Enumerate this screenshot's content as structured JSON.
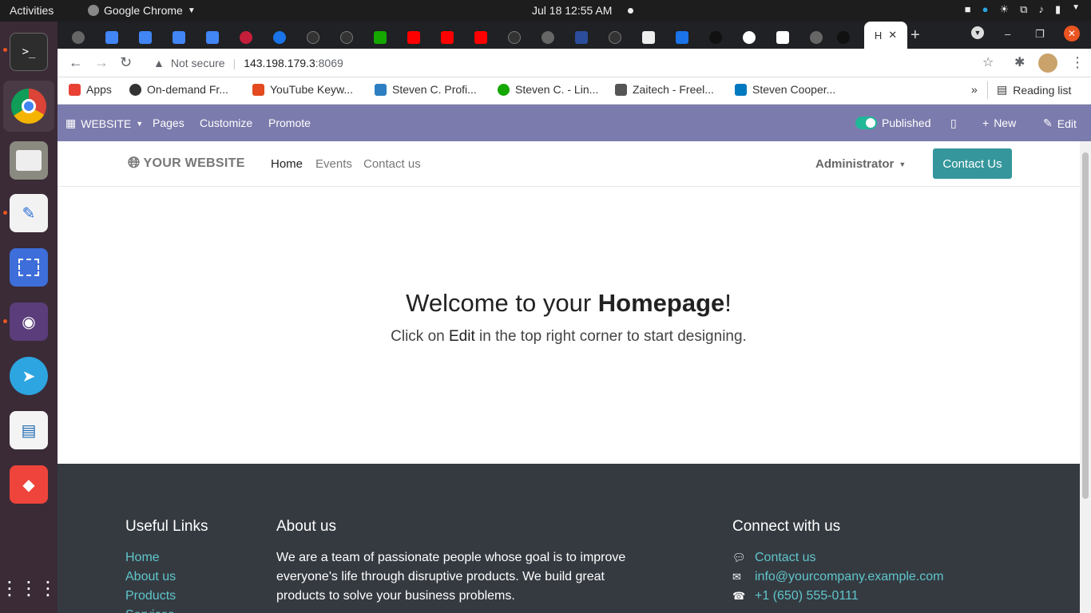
{
  "system": {
    "activities": "Activities",
    "app_name": "Google Chrome",
    "clock": "Jul 18  12:55 AM"
  },
  "browser": {
    "active_tab_label": "H",
    "not_secure": "Not secure",
    "url_host": "143.198.179.3",
    "url_port": ":8069",
    "bookmarks": [
      "Apps",
      "On-demand Fr...",
      "YouTube Keyw...",
      "Steven C. Profi...",
      "Steven C. - Lin...",
      "Zaitech - Freel...",
      "Steven Cooper..."
    ],
    "reading_list": "Reading list"
  },
  "odoo_bar": {
    "website": "WEBSITE",
    "pages": "Pages",
    "customize": "Customize",
    "promote": "Promote",
    "published": "Published",
    "new": "New",
    "edit": "Edit"
  },
  "site": {
    "logo": "YOUR WEBSITE",
    "menu": [
      "Home",
      "Events",
      "Contact us"
    ],
    "admin": "Administrator",
    "cta": "Contact Us",
    "hero_title_pre": "Welcome to your ",
    "hero_title_bold": "Homepage",
    "hero_title_post": "!",
    "hero_sub_pre": "Click on ",
    "hero_sub_bold": "Edit",
    "hero_sub_post": " in the top right corner to start designing."
  },
  "footer": {
    "links_title": "Useful Links",
    "links": [
      "Home",
      "About us",
      "Products",
      "Services"
    ],
    "about_title": "About us",
    "about_text": "We are a team of passionate people whose goal is to improve everyone's life through disruptive products. We build great products to solve your business problems.",
    "connect_title": "Connect with us",
    "contact_link": "Contact us",
    "email": "info@yourcompany.example.com",
    "phone": "+1 (650) 555-0111"
  }
}
